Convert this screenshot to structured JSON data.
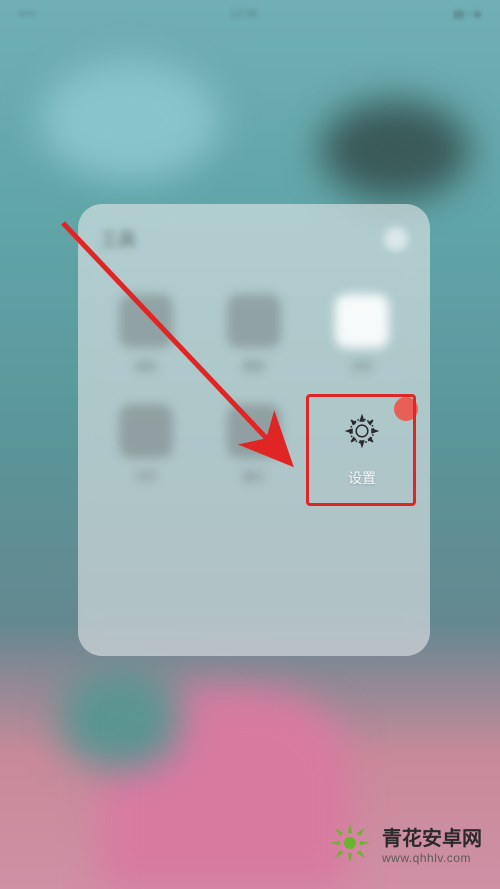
{
  "status_bar": {
    "time": "12:00"
  },
  "folder": {
    "title": "工具",
    "apps": [
      {
        "label": "相机"
      },
      {
        "label": "图库"
      },
      {
        "label": "日历"
      },
      {
        "label": "文件"
      },
      {
        "label": "备忘"
      },
      {
        "label": "设置"
      }
    ]
  },
  "highlight": {
    "color": "#e02525"
  },
  "watermark": {
    "title": "青花安卓网",
    "url": "www.qhhlv.com"
  }
}
